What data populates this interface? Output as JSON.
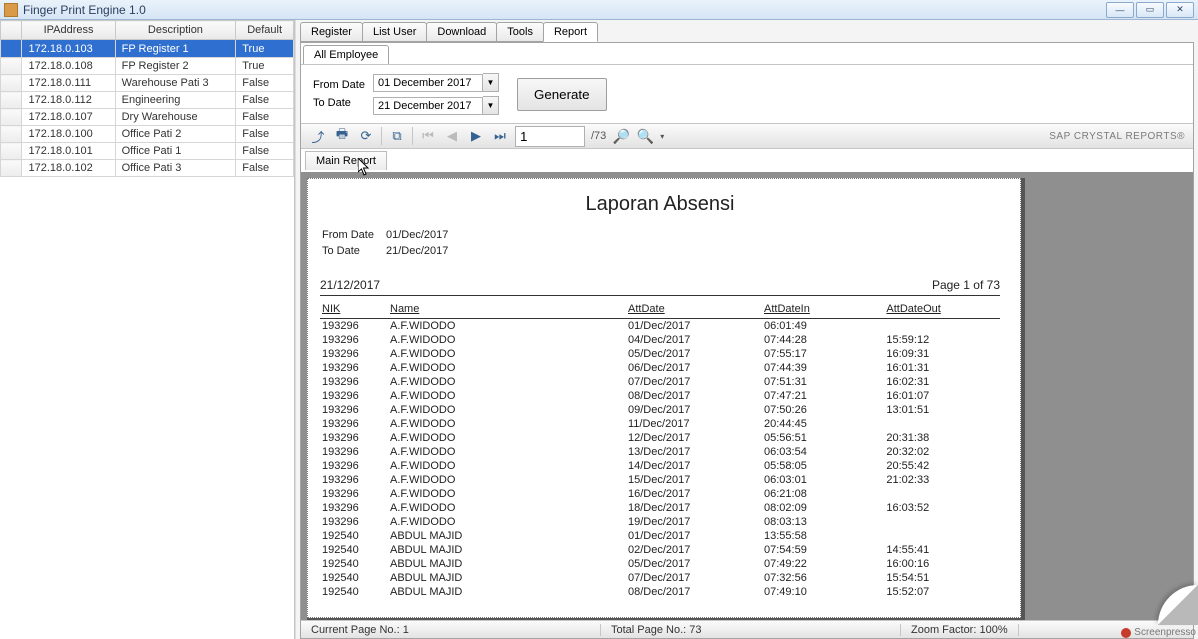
{
  "window": {
    "title": "Finger Print Engine 1.0"
  },
  "left_grid": {
    "headers": [
      "IPAddress",
      "Description",
      "Default"
    ],
    "selected_index": 0,
    "rows": [
      {
        "ip": "172.18.0.103",
        "desc": "FP Register 1",
        "def": "True"
      },
      {
        "ip": "172.18.0.108",
        "desc": "FP Register 2",
        "def": "True"
      },
      {
        "ip": "172.18.0.111",
        "desc": "Warehouse Pati 3",
        "def": "False"
      },
      {
        "ip": "172.18.0.112",
        "desc": "Engineering",
        "def": "False"
      },
      {
        "ip": "172.18.0.107",
        "desc": "Dry Warehouse",
        "def": "False"
      },
      {
        "ip": "172.18.0.100",
        "desc": "Office Pati 2",
        "def": "False"
      },
      {
        "ip": "172.18.0.101",
        "desc": "Office Pati 1",
        "def": "False"
      },
      {
        "ip": "172.18.0.102",
        "desc": "Office Pati 3",
        "def": "False"
      }
    ]
  },
  "tabs": {
    "items": [
      "Register",
      "List User",
      "Download",
      "Tools",
      "Report"
    ],
    "active_index": 4
  },
  "subtab": {
    "label": "All Employee"
  },
  "filter": {
    "from_label": "From Date",
    "to_label": "To Date",
    "from_value": "01 December 2017",
    "to_value": "21 December 2017",
    "generate_label": "Generate"
  },
  "rpt_toolbar": {
    "page_value": "1",
    "page_count": "/73",
    "brand": "SAP CRYSTAL REPORTS®"
  },
  "rpt_subtab": {
    "label": "Main Report"
  },
  "report": {
    "title": "Laporan Absensi",
    "from_label": "From Date",
    "from_value": "01/Dec/2017",
    "to_label": "To Date",
    "to_value": "21/Dec/2017",
    "print_date": "21/12/2017",
    "page_label": "Page 1 of 73",
    "headers": [
      "NIK",
      "Name",
      "AttDate",
      "AttDateIn",
      "AttDateOut"
    ],
    "rows": [
      {
        "nik": "193296",
        "name": "A.F.WIDODO",
        "d": "01/Dec/2017",
        "in": "06:01:49",
        "out": ""
      },
      {
        "nik": "193296",
        "name": "A.F.WIDODO",
        "d": "04/Dec/2017",
        "in": "07:44:28",
        "out": "15:59:12"
      },
      {
        "nik": "193296",
        "name": "A.F.WIDODO",
        "d": "05/Dec/2017",
        "in": "07:55:17",
        "out": "16:09:31"
      },
      {
        "nik": "193296",
        "name": "A.F.WIDODO",
        "d": "06/Dec/2017",
        "in": "07:44:39",
        "out": "16:01:31"
      },
      {
        "nik": "193296",
        "name": "A.F.WIDODO",
        "d": "07/Dec/2017",
        "in": "07:51:31",
        "out": "16:02:31"
      },
      {
        "nik": "193296",
        "name": "A.F.WIDODO",
        "d": "08/Dec/2017",
        "in": "07:47:21",
        "out": "16:01:07"
      },
      {
        "nik": "193296",
        "name": "A.F.WIDODO",
        "d": "09/Dec/2017",
        "in": "07:50:26",
        "out": "13:01:51"
      },
      {
        "nik": "193296",
        "name": "A.F.WIDODO",
        "d": "11/Dec/2017",
        "in": "20:44:45",
        "out": ""
      },
      {
        "nik": "193296",
        "name": "A.F.WIDODO",
        "d": "12/Dec/2017",
        "in": "05:56:51",
        "out": "20:31:38"
      },
      {
        "nik": "193296",
        "name": "A.F.WIDODO",
        "d": "13/Dec/2017",
        "in": "06:03:54",
        "out": "20:32:02"
      },
      {
        "nik": "193296",
        "name": "A.F.WIDODO",
        "d": "14/Dec/2017",
        "in": "05:58:05",
        "out": "20:55:42"
      },
      {
        "nik": "193296",
        "name": "A.F.WIDODO",
        "d": "15/Dec/2017",
        "in": "06:03:01",
        "out": "21:02:33"
      },
      {
        "nik": "193296",
        "name": "A.F.WIDODO",
        "d": "16/Dec/2017",
        "in": "06:21:08",
        "out": ""
      },
      {
        "nik": "193296",
        "name": "A.F.WIDODO",
        "d": "18/Dec/2017",
        "in": "08:02:09",
        "out": "16:03:52"
      },
      {
        "nik": "193296",
        "name": "A.F.WIDODO",
        "d": "19/Dec/2017",
        "in": "08:03:13",
        "out": ""
      },
      {
        "nik": "192540",
        "name": "ABDUL MAJID",
        "d": "01/Dec/2017",
        "in": "13:55:58",
        "out": ""
      },
      {
        "nik": "192540",
        "name": "ABDUL MAJID",
        "d": "02/Dec/2017",
        "in": "07:54:59",
        "out": "14:55:41"
      },
      {
        "nik": "192540",
        "name": "ABDUL MAJID",
        "d": "05/Dec/2017",
        "in": "07:49:22",
        "out": "16:00:16"
      },
      {
        "nik": "192540",
        "name": "ABDUL MAJID",
        "d": "07/Dec/2017",
        "in": "07:32:56",
        "out": "15:54:51"
      },
      {
        "nik": "192540",
        "name": "ABDUL MAJID",
        "d": "08/Dec/2017",
        "in": "07:49:10",
        "out": "15:52:07"
      }
    ]
  },
  "status": {
    "current": "Current Page No.: 1",
    "total": "Total Page No.: 73",
    "zoom": "Zoom Factor: 100%"
  },
  "watermark": "Screenpresso"
}
